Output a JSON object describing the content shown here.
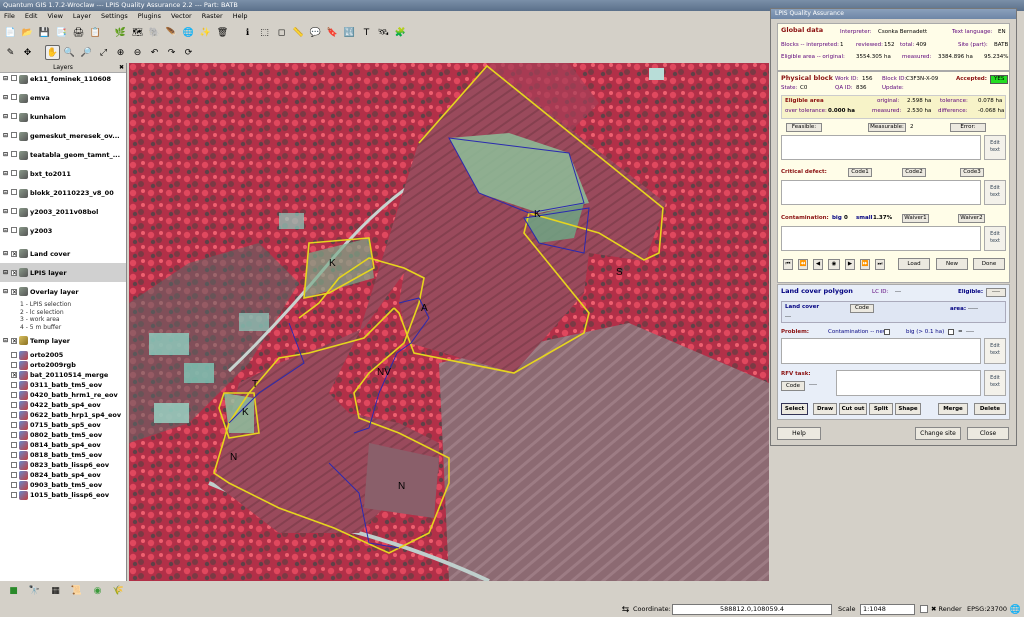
{
  "window": {
    "title": "Quantum GIS 1.7.2-Wroclaw --- LPIS Quality Assurance 2.2 --- Part: BATB"
  },
  "menu": [
    "File",
    "Edit",
    "View",
    "Layer",
    "Settings",
    "Plugins",
    "Vector",
    "Raster",
    "Help"
  ],
  "layers_panel": {
    "title": "Layers",
    "items": [
      {
        "name": "ek11_fominek_110608",
        "checked": false,
        "icon": "polygon-layer-icon"
      },
      {
        "name": "emva",
        "checked": false,
        "icon": "polygon-layer-icon"
      },
      {
        "name": "kunhalom",
        "checked": false,
        "icon": "polygon-layer-icon"
      },
      {
        "name": "gemeskut_meresek_ov...",
        "checked": false,
        "icon": "polygon-layer-icon"
      },
      {
        "name": "teatabla_geom_tamnt_...",
        "checked": false,
        "icon": "polygon-layer-icon"
      },
      {
        "name": "bxt_to2011",
        "checked": false,
        "icon": "polygon-layer-icon"
      },
      {
        "name": "blokk_20110223_v8_00",
        "checked": false,
        "icon": "polygon-layer-icon"
      },
      {
        "name": "y2003_2011v08bol",
        "checked": false,
        "icon": "polygon-layer-icon"
      },
      {
        "name": "y2003",
        "checked": false,
        "icon": "polygon-layer-icon"
      },
      {
        "name": "Land cover",
        "checked": true,
        "icon": "polygon-layer-icon"
      },
      {
        "name": "LPIS layer",
        "checked": true,
        "icon": "polygon-layer-icon",
        "selected": true
      },
      {
        "name": "Overlay layer",
        "checked": true,
        "icon": "polygon-layer-icon",
        "legend": [
          "1 - LPIS selection",
          "2 - lc selection",
          "3 - work area",
          "4 - 5 m buffer"
        ]
      },
      {
        "name": "Temp layer",
        "checked": true,
        "icon": "line-layer-icon"
      },
      {
        "name": "orto2005",
        "checked": false,
        "icon": "raster-layer-icon"
      },
      {
        "name": "orto2009rgb",
        "checked": false,
        "icon": "raster-layer-icon"
      },
      {
        "name": "bat_20110514_merge",
        "checked": true,
        "icon": "raster-layer-icon"
      },
      {
        "name": "0311_batb_tm5_eov",
        "checked": false,
        "icon": "raster-layer-icon"
      },
      {
        "name": "0420_batb_hrm1_re_eov",
        "checked": false,
        "icon": "raster-layer-icon"
      },
      {
        "name": "0422_batb_sp4_eov",
        "checked": false,
        "icon": "raster-layer-icon"
      },
      {
        "name": "0622_batb_hrp1_sp4_eov",
        "checked": false,
        "icon": "raster-layer-icon"
      },
      {
        "name": "0715_batb_sp5_eov",
        "checked": false,
        "icon": "raster-layer-icon"
      },
      {
        "name": "0802_batb_tm5_eov",
        "checked": false,
        "icon": "raster-layer-icon"
      },
      {
        "name": "0814_batb_sp4_eov",
        "checked": false,
        "icon": "raster-layer-icon"
      },
      {
        "name": "0818_batb_tm5_eov",
        "checked": false,
        "icon": "raster-layer-icon"
      },
      {
        "name": "0823_batb_lissp6_eov",
        "checked": false,
        "icon": "raster-layer-icon"
      },
      {
        "name": "0824_batb_sp4_eov",
        "checked": false,
        "icon": "raster-layer-icon"
      },
      {
        "name": "0903_batb_tm5_eov",
        "checked": false,
        "icon": "raster-layer-icon"
      },
      {
        "name": "1015_batb_lissp6_eov",
        "checked": false,
        "icon": "raster-layer-icon"
      }
    ]
  },
  "map": {
    "labels": [
      "K",
      "A",
      "NV",
      "T",
      "K",
      "N",
      "N",
      "K",
      "S"
    ]
  },
  "status": {
    "coordinate_label": "Coordinate:",
    "coordinate": "588812.0,108059.4",
    "scale_label": "Scale",
    "scale": "1:1048",
    "render_label": "Render",
    "crs": "EPSG:23700"
  },
  "qa": {
    "title": "LPIS Quality Assurance",
    "global": {
      "heading": "Global data",
      "interpreter_label": "Interpreter:",
      "interpreter": "Csonka Bernadett",
      "lang_label": "Text language:",
      "lang": "EN",
      "blocks_label": "Blocks -- interpreted:",
      "interpreted": "1",
      "reviewed_label": "reviewed:",
      "reviewed": "152",
      "total_label": "total:",
      "total": "409",
      "site_label": "Site (part):",
      "site": "BATB",
      "area_label": "Eligible area -- original:",
      "area_orig": "3554.305 ha",
      "measured_label": "measured:",
      "measured": "3384.896 ha",
      "percent": "95.234%"
    },
    "block": {
      "heading": "Physical block",
      "work_label": "Work ID:",
      "work_id": "156",
      "block_label": "Block ID:",
      "block_id": "C3F3N-X-09",
      "accepted_label": "Accepted:",
      "accepted": "YES",
      "state_label": "State:",
      "state": "C0",
      "qa_label": "QA ID:",
      "qa_id": "836",
      "update_label": "Update:",
      "ea_heading": "Eligible area",
      "orig_label": "original:",
      "orig": "2.598 ha",
      "tol_label": "tolerance:",
      "tol": "0.078 ha",
      "over_label": "over tolerance:",
      "over": "0.000 ha",
      "meas_label": "measured:",
      "meas": "2.530 ha",
      "diff_label": "difference:",
      "diff": "-0.068 ha",
      "feasible": "Feasible:",
      "measurable": "Measurable:",
      "measurable_val": "2",
      "error": "Error:",
      "edit_text": "Edit text",
      "critical_label": "Critical defect:",
      "code1": "Code1",
      "code2": "Code2",
      "code3": "Code3",
      "contam_label": "Contamination:",
      "big_label": "big",
      "big": "0",
      "small_label": "small",
      "small": "1.37%",
      "waiver1": "Waiver1",
      "waiver2": "Waiver2",
      "load": "Load",
      "new": "New",
      "done": "Done"
    },
    "lc": {
      "heading": "Land cover polygon",
      "lcid_label": "LC ID:",
      "lcid": "---",
      "eligible_label": "Eligible:",
      "eligible": "----",
      "lc_label": "Land cover",
      "lc_val": "---",
      "code": "Code",
      "area_label": "area:",
      "area": "-----",
      "problem_label": "Problem:",
      "contam_new": "Contamination -- new",
      "big_label": "big (> 0.1 ha)",
      "eq": "=",
      "dash": "----",
      "rfv_label": "RFV task:",
      "rfv_code": "Code",
      "rfv_val": "----",
      "select": "Select",
      "draw": "Draw",
      "cutout": "Cut out",
      "split": "Split",
      "shape": "Shape",
      "merge": "Merge",
      "delete": "Delete"
    },
    "help": "Help",
    "change_site": "Change site",
    "close": "Close"
  },
  "colors": {
    "accept": "#22dd22",
    "title_grad": "#6e86a6",
    "map_bg": "#b8324a"
  }
}
